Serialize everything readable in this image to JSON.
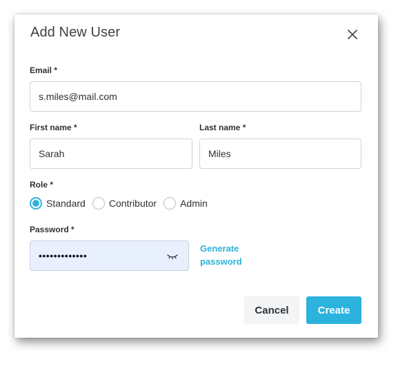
{
  "dialog": {
    "title": "Add New User",
    "close_icon": "close-icon"
  },
  "email": {
    "label": "Email *",
    "value": "s.miles@mail.com"
  },
  "first_name": {
    "label": "First name *",
    "value": "Sarah"
  },
  "last_name": {
    "label": "Last name *",
    "value": "Miles"
  },
  "role": {
    "label": "Role *",
    "options": [
      "Standard",
      "Contributor",
      "Admin"
    ],
    "selected": "Standard"
  },
  "password": {
    "label": "Password *",
    "masked_value": "•••••••••••••",
    "toggle_icon": "eye-closed-icon",
    "generate_link": "Generate password"
  },
  "actions": {
    "cancel_label": "Cancel",
    "create_label": "Create"
  },
  "colors": {
    "accent": "#2bb3dd",
    "password_bg": "#e8f0fe",
    "cancel_bg": "#f3f4f5"
  }
}
